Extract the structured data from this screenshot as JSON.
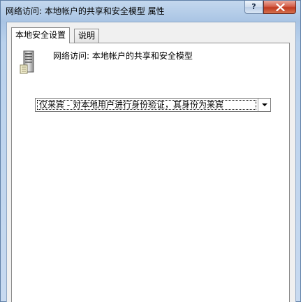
{
  "window": {
    "title": "网络访问: 本地帐户的共享和安全模型 属性",
    "help_label": "?"
  },
  "tabs": [
    {
      "label": "本地安全设置",
      "active": true
    },
    {
      "label": "说明",
      "active": false
    }
  ],
  "policy": {
    "icon": "server-icon",
    "name": "网络访问: 本地帐户的共享和安全模型"
  },
  "dropdown": {
    "selected": "仅来宾 - 对本地用户进行身份验证，其身份为来宾"
  },
  "colors": {
    "close_button": "#c9442c",
    "frame": "#b9d1ec",
    "panel": "#ffffff"
  }
}
